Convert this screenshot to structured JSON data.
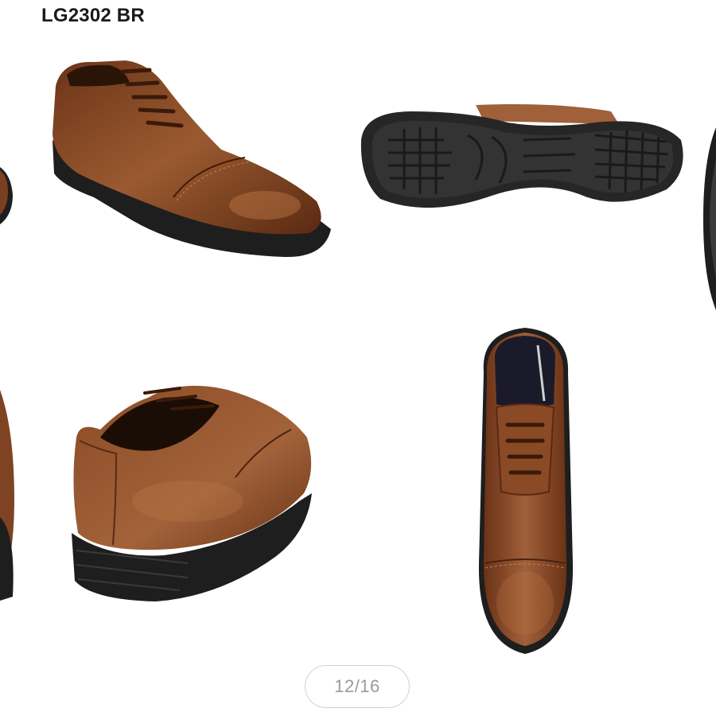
{
  "product": {
    "model_label": "LG2302 BR"
  },
  "gallery": {
    "counter": "12/16",
    "current_index": 12,
    "total": 16,
    "views": [
      {
        "icon": "shoe-side-view-icon"
      },
      {
        "icon": "shoe-sole-view-icon"
      },
      {
        "icon": "shoe-rear-view-icon"
      },
      {
        "icon": "shoe-top-view-icon"
      },
      {
        "icon": "shoe-edge-partial-icon"
      }
    ]
  },
  "colors": {
    "leather": "#8a4a26",
    "leather_light": "#b06a3c",
    "sole": "#1e1e1e",
    "counter_border": "#d2d2d2",
    "counter_text": "#9a9a9a"
  }
}
